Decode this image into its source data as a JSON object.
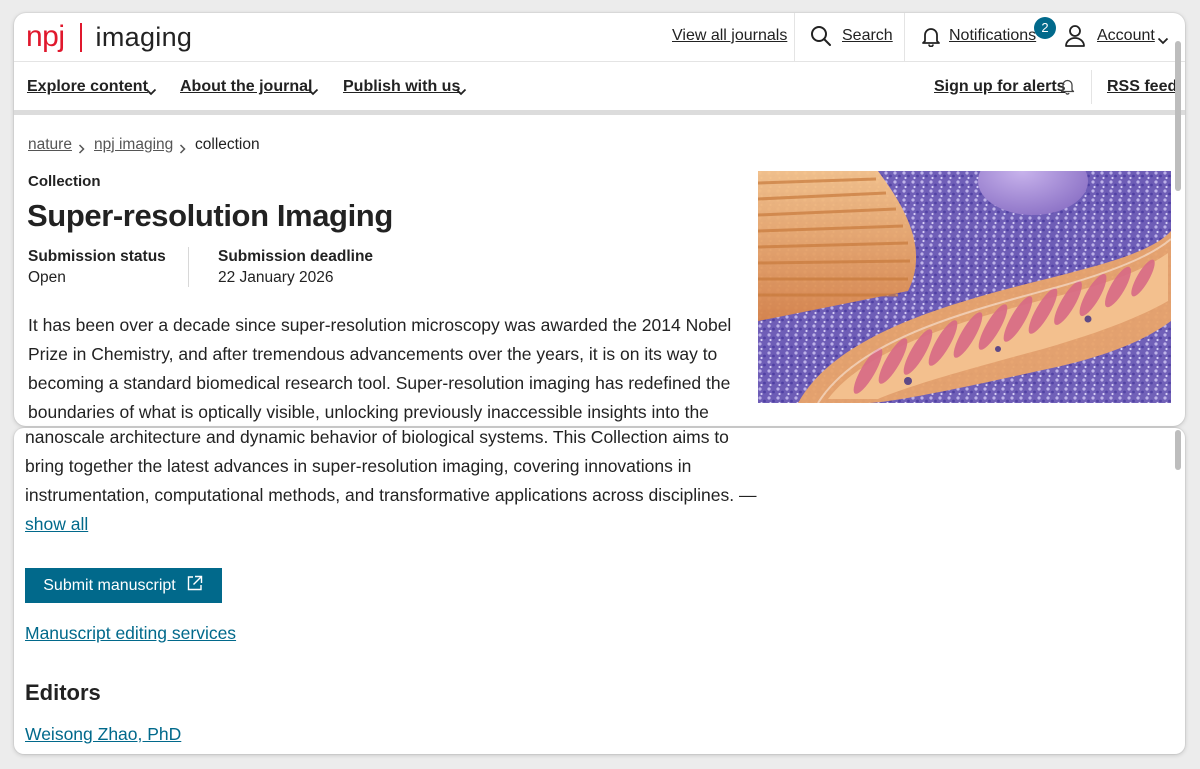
{
  "header": {
    "logo_brand": "npj",
    "logo_journal": "imaging",
    "view_all_journals": "View all journals",
    "search_label": "Search",
    "notifications_label": "Notifications",
    "notifications_count": "2",
    "account_label": "Account"
  },
  "nav": {
    "explore": "Explore content",
    "about": "About the journal",
    "publish": "Publish with us",
    "alerts": "Sign up for alerts",
    "rss": "RSS feed"
  },
  "breadcrumb": [
    "nature",
    "npj imaging",
    "collection"
  ],
  "collection": {
    "kicker": "Collection",
    "title": "Super-resolution Imaging",
    "status_label": "Submission status",
    "status_value": "Open",
    "deadline_label": "Submission deadline",
    "deadline_value": "22 January 2026",
    "description_lines_top": [
      "It has been over a decade since super-resolution microscopy was awarded the 2014 Nobel",
      "Prize in Chemistry, and after tremendous advancements over the years, it is on its way to",
      "becoming a standard biomedical research tool. Super-resolution imaging has redefined the",
      "boundaries of what is optically visible, unlocking previously inaccessible insights into the"
    ],
    "description_lines_bottom": [
      "nanoscale architecture and dynamic behavior of biological systems. This Collection aims to",
      "bring together the latest advances in super-resolution imaging, covering innovations in",
      "instrumentation, computational methods, and transformative applications across disciplines. —"
    ],
    "show_all": "show all",
    "submit_label": "Submit manuscript",
    "editing_services": "Manuscript editing services",
    "editors_heading": "Editors",
    "editors": [
      "Weisong Zhao, PhD"
    ]
  },
  "colors": {
    "brand_red": "#e0182d",
    "link_blue": "#01698b",
    "text": "#222222"
  },
  "icons": [
    "search-icon",
    "bell-icon",
    "user-icon",
    "chevron-down-icon",
    "chevron-right-icon",
    "external-link-icon"
  ]
}
